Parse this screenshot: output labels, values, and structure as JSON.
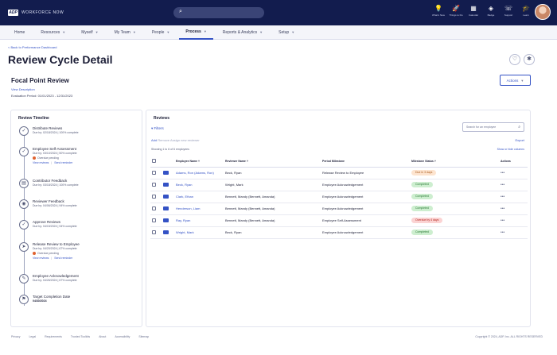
{
  "app": {
    "logo_mark": "ADP",
    "logo_text": "WORKFORCE NOW",
    "search_icon": "search-icon"
  },
  "topbar_icons": [
    {
      "name": "lightbulb-icon",
      "glyph": "💡",
      "label": "What's New"
    },
    {
      "name": "rocket-icon",
      "glyph": "🚀",
      "label": "Things to Do"
    },
    {
      "name": "calendar-icon",
      "glyph": "▦",
      "label": "Calendar"
    },
    {
      "name": "badge-icon",
      "glyph": "◈",
      "label": "Badge"
    },
    {
      "name": "support-icon",
      "glyph": "☏",
      "label": "Support"
    },
    {
      "name": "learn-icon",
      "glyph": "🎓",
      "label": "Learn"
    }
  ],
  "nav": [
    {
      "label": "Home",
      "chevron": false,
      "active": false
    },
    {
      "label": "Resources",
      "chevron": true,
      "active": false
    },
    {
      "label": "Myself",
      "chevron": true,
      "active": false
    },
    {
      "label": "My Team",
      "chevron": true,
      "active": false
    },
    {
      "label": "People",
      "chevron": true,
      "active": false
    },
    {
      "label": "Process",
      "chevron": true,
      "active": true
    },
    {
      "label": "Reports & Analytics",
      "chevron": true,
      "active": false
    },
    {
      "label": "Setup",
      "chevron": true,
      "active": false
    }
  ],
  "page": {
    "back_link": "< Back to Performance Dashboard",
    "title": "Review Cycle Detail",
    "review_name": "Focal Point Review",
    "view_description": "View Description",
    "evaluation_period": "Evaluation Period: 01/01/2023 - 12/31/2023",
    "actions_label": "Actions"
  },
  "timeline": {
    "title": "Review Timeline",
    "steps": [
      {
        "icon": "checkmark-icon",
        "glyph": "✓",
        "name": "Distribute Reviews",
        "due": "Due by: 02/18/2024 | 100% complete",
        "flag": "",
        "links": []
      },
      {
        "icon": "checkmark-icon",
        "glyph": "✓",
        "name": "Employee Self-Assessment",
        "due": "Due by: 03/10/2024 | 50% complete",
        "flag": "Overdue pending",
        "links": [
          "View reviews",
          "Send reminder"
        ]
      },
      {
        "icon": "document-icon",
        "glyph": "▤",
        "name": "Contributor Feedback",
        "due": "Due by: 03/18/2024 | 100% complete",
        "flag": "",
        "links": []
      },
      {
        "icon": "person-review-icon",
        "glyph": "◉",
        "name": "Reviewer Feedback",
        "due": "Due by: 04/06/2024 | 94% complete",
        "flag": "",
        "links": []
      },
      {
        "icon": "approve-icon",
        "glyph": "✓",
        "name": "Approve Reviews",
        "due": "Due by: 04/15/2024 | 94% complete",
        "flag": "",
        "links": []
      },
      {
        "icon": "release-icon",
        "glyph": "➤",
        "name": "Release Review to Employee",
        "due": "Due by: 04/20/2024 | 67% complete",
        "flag": "Overdue pending",
        "links": [
          "View reviews",
          "Send reminder"
        ]
      },
      {
        "icon": "acknowledge-icon",
        "glyph": "✎",
        "name": "Employee Acknowledgement",
        "due": "Due by: 04/26/2024 | 67% complete",
        "flag": "",
        "links": []
      },
      {
        "icon": "flag-icon",
        "glyph": "⚑",
        "name": "Target Completion Date",
        "due": "",
        "date": "04/30/2024",
        "flag": "",
        "links": []
      }
    ]
  },
  "reviews": {
    "title": "Reviews",
    "filters_label": "Filters",
    "search_placeholder": "Search for an employee",
    "bulk_actions": [
      "Add",
      "Remove",
      "Assign new reviewer"
    ],
    "export_label": "Export",
    "showing_text": "Showing 1 to 6 of 6 employees",
    "show_hide_label": "Show or hide columns",
    "columns": [
      "Employee Name",
      "Reviewer Name",
      "Period Milestone",
      "Milestone Status",
      "Actions"
    ],
    "rows": [
      {
        "employee": "Adams, Ron (Adams, Ron)",
        "reviewer": "Beck, Ryan",
        "milestone": "Release Review to Employee",
        "status": "Due in 3 days",
        "status_bg": "#fde4cf",
        "status_fg": "#a85a1e"
      },
      {
        "employee": "Beck, Ryan",
        "reviewer": "Wright, Mark",
        "milestone": "Employee Acknowledgement",
        "status": "Completed",
        "status_bg": "#cdeecf",
        "status_fg": "#2b7a36"
      },
      {
        "employee": "Clark, Ethan",
        "reviewer": "Bennett, Mandy (Bennett, Amanda)",
        "milestone": "Employee Acknowledgement",
        "status": "Completed",
        "status_bg": "#cdeecf",
        "status_fg": "#2b7a36"
      },
      {
        "employee": "Henderson, Liam",
        "reviewer": "Bennett, Mandy (Bennett, Amanda)",
        "milestone": "Employee Acknowledgement",
        "status": "Completed",
        "status_bg": "#cdeecf",
        "status_fg": "#2b7a36"
      },
      {
        "employee": "Ray, Ryan",
        "reviewer": "Bennett, Mandy (Bennett, Amanda)",
        "milestone": "Employee Self-Assessment",
        "status": "Overdue by 4 days",
        "status_bg": "#fbd3d3",
        "status_fg": "#b3261e"
      },
      {
        "employee": "Wright, Mark",
        "reviewer": "Beck, Ryan",
        "milestone": "Employee Acknowledgement",
        "status": "Completed",
        "status_bg": "#cdeecf",
        "status_fg": "#2b7a36"
      }
    ]
  },
  "footer": {
    "links": [
      "Privacy",
      "Legal",
      "Requirements",
      "Trusted Toolkits",
      "About",
      "Accessibility",
      "Sitemap"
    ],
    "copyright": "Copyright © 2024, ADP, Inc. ALL RIGHTS RESERVED"
  },
  "colors": {
    "topbar": "#121c4e",
    "accent": "#3452c5"
  }
}
